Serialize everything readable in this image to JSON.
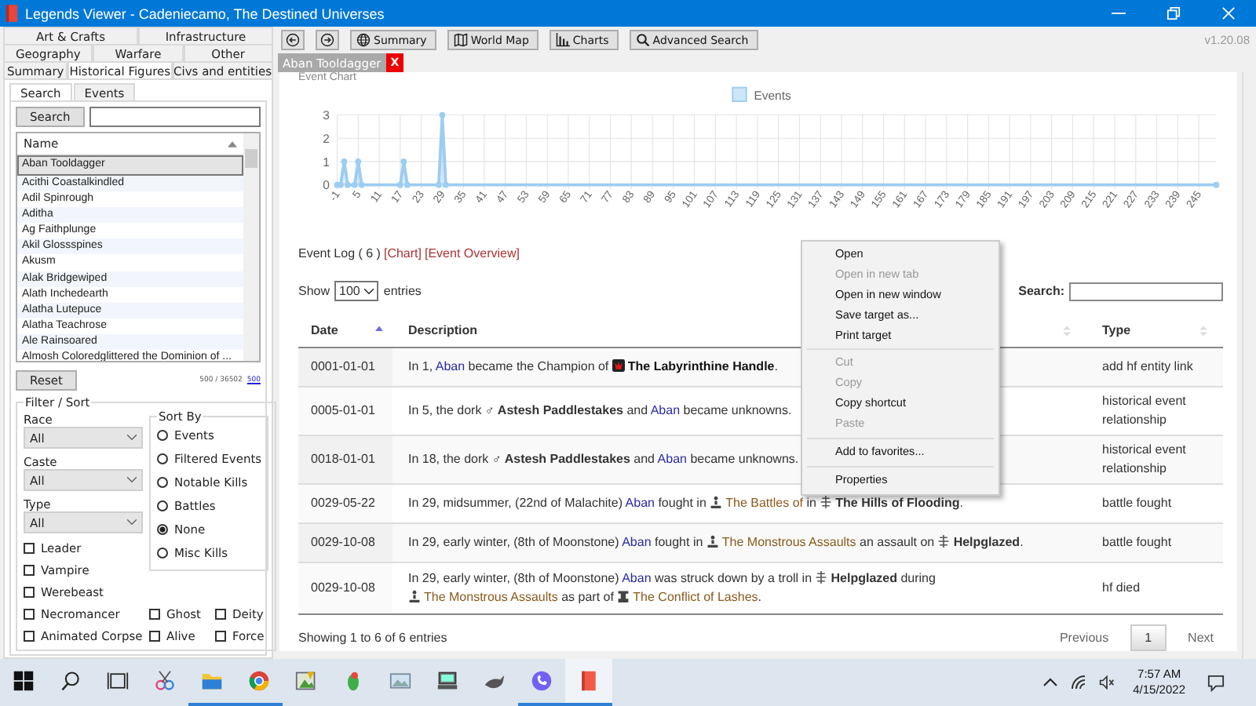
{
  "window": {
    "title": "Legends Viewer - Cadeniecamo, The Destined Universes"
  },
  "tab_rows": [
    {
      "tabs": [
        {
          "label": "Art & Crafts",
          "selected": false
        },
        {
          "label": "Infrastructure",
          "selected": false
        }
      ]
    },
    {
      "tabs": [
        {
          "label": "Geography",
          "selected": false
        },
        {
          "label": "Warfare",
          "selected": false
        },
        {
          "label": "Other",
          "selected": false
        }
      ]
    },
    {
      "tabs": [
        {
          "label": "Summary",
          "selected": false
        },
        {
          "label": "Historical Figures",
          "selected": true
        },
        {
          "label": "Civs and entities",
          "selected": false
        }
      ]
    }
  ],
  "sub_tabs": [
    {
      "label": "Search",
      "selected": true
    },
    {
      "label": "Events",
      "selected": false
    }
  ],
  "search_button": "Search",
  "list": {
    "column": "Name",
    "items": [
      {
        "name": "Aban Tooldagger",
        "selected": true
      },
      {
        "name": "Acithi Coastalkindled",
        "selected": false
      },
      {
        "name": "Adil Spinrough",
        "selected": false
      },
      {
        "name": "Aditha",
        "selected": false
      },
      {
        "name": "Ag Faithplunge",
        "selected": false
      },
      {
        "name": "Akil Glossspines",
        "selected": false
      },
      {
        "name": "Akusm",
        "selected": false
      },
      {
        "name": "Alak Bridgewiped",
        "selected": false
      },
      {
        "name": "Alath Inchedearth",
        "selected": false
      },
      {
        "name": "Alatha Lutepuce",
        "selected": false
      },
      {
        "name": "Alatha Teachrose",
        "selected": false
      },
      {
        "name": "Ale Rainsoared",
        "selected": false
      },
      {
        "name": "Almosh Coloredglittered the Dominion of ...",
        "selected": false
      }
    ]
  },
  "reset_button": "Reset",
  "count": "500 / 36502",
  "count_link": "500",
  "filter": {
    "title": "Filter / Sort",
    "dropdowns": [
      {
        "label": "Race",
        "value": "All"
      },
      {
        "label": "Caste",
        "value": "All"
      },
      {
        "label": "Type",
        "value": "All"
      }
    ],
    "checkboxes": [
      {
        "label": "Leader",
        "checked": false
      },
      {
        "label": "Vampire",
        "checked": false
      },
      {
        "label": "Werebeast",
        "checked": false
      },
      {
        "label": "Necromancer",
        "checked": false
      },
      {
        "label": "Ghost",
        "checked": false
      },
      {
        "label": "Deity",
        "checked": false
      },
      {
        "label": "Animated Corpse",
        "checked": false
      },
      {
        "label": "Alive",
        "checked": false
      },
      {
        "label": "Force",
        "checked": false
      }
    ],
    "sort": {
      "title": "Sort By",
      "options": [
        {
          "label": "Events",
          "selected": false
        },
        {
          "label": "Filtered Events",
          "selected": false
        },
        {
          "label": "Notable Kills",
          "selected": false
        },
        {
          "label": "Battles",
          "selected": false
        },
        {
          "label": "None",
          "selected": true
        },
        {
          "label": "Misc Kills",
          "selected": false
        }
      ]
    }
  },
  "toolbar": {
    "buttons": [
      {
        "kind": "back"
      },
      {
        "kind": "forward"
      },
      {
        "kind": "globe",
        "label": "Summary"
      },
      {
        "kind": "map",
        "label": "World Map"
      },
      {
        "kind": "chart",
        "label": "Charts"
      },
      {
        "kind": "search",
        "label": "Advanced Search"
      }
    ],
    "version": "v1.20.08"
  },
  "doc_tab": {
    "label": "Aban Tooldagger",
    "close": "X"
  },
  "event_chart": {
    "title": "Event Chart",
    "chart_data": {
      "type": "line",
      "grid": true,
      "series": [
        {
          "name": "Events",
          "color": "#9ccdf2",
          "marker": "circle",
          "values": [
            0,
            0,
            1,
            0,
            0,
            1,
            0,
            0,
            1,
            0,
            0,
            3,
            0,
            0
          ]
        }
      ],
      "x": [
        -1,
        0,
        1,
        2,
        4,
        5,
        6,
        17,
        18,
        19,
        28,
        29,
        30,
        250
      ],
      "xlim": [
        -1,
        250
      ],
      "ylim": [
        0,
        3
      ],
      "yticks": [
        0,
        1,
        2,
        3
      ],
      "xticks": [
        -1,
        5,
        11,
        17,
        23,
        29,
        35,
        41,
        47,
        53,
        59,
        65,
        71,
        77,
        83,
        89,
        95,
        101,
        107,
        113,
        119,
        125,
        131,
        137,
        143,
        149,
        155,
        161,
        167,
        173,
        179,
        185,
        191,
        197,
        203,
        209,
        215,
        221,
        227,
        233,
        239,
        245
      ]
    }
  },
  "event_log": {
    "title": "Event Log ( 6 )",
    "links": [
      "[Chart]",
      "[Event Overview]"
    ]
  },
  "table": {
    "show_label": "Show",
    "page_size": "100",
    "entries_label": "entries",
    "search_label": "Search:",
    "columns": [
      {
        "label": "Date",
        "sorted": true
      },
      {
        "label": "Description",
        "sorted": false
      },
      {
        "label": "Type",
        "sorted": false
      }
    ],
    "rows": [
      {
        "date": "0001-01-01",
        "type": "add hf entity link",
        "description": [
          {
            "kind": "text",
            "text": "In 1, "
          },
          {
            "kind": "hf",
            "text": "Aban"
          },
          {
            "kind": "text",
            "text": " became the Champion of "
          },
          {
            "kind": "artifact",
            "text": "The Labyrinthine Handle"
          },
          {
            "kind": "text",
            "text": "."
          }
        ]
      },
      {
        "date": "0005-01-01",
        "type": "historical event relationship",
        "description": [
          {
            "kind": "text",
            "text": "In 5, the dork "
          },
          {
            "kind": "figure",
            "icon": "♂",
            "text": "Astesh Paddlestakes"
          },
          {
            "kind": "text",
            "text": " and "
          },
          {
            "kind": "hf",
            "text": "Aban"
          },
          {
            "kind": "text",
            "text": " became unknowns."
          }
        ]
      },
      {
        "date": "0018-01-01",
        "type": "historical event relationship",
        "description": [
          {
            "kind": "text",
            "text": "In 18, the dork "
          },
          {
            "kind": "figure",
            "icon": "♂",
            "text": "Astesh Paddlestakes"
          },
          {
            "kind": "text",
            "text": " and "
          },
          {
            "kind": "hf",
            "text": "Aban"
          },
          {
            "kind": "text",
            "text": " became unknowns."
          }
        ]
      },
      {
        "date": "0029-05-22",
        "type": "battle fought",
        "description": [
          {
            "kind": "text",
            "text": "In 29, midsummer, (22nd of Malachite) "
          },
          {
            "kind": "hf",
            "text": "Aban"
          },
          {
            "kind": "text",
            "text": " fought in "
          },
          {
            "kind": "battle",
            "text": "The Battles of"
          },
          {
            "kind": "text",
            "text": " in "
          },
          {
            "kind": "site",
            "text": "The Hills of Flooding"
          },
          {
            "kind": "text",
            "text": "."
          }
        ]
      },
      {
        "date": "0029-10-08",
        "type": "battle fought",
        "description": [
          {
            "kind": "text",
            "text": "In 29, early winter, (8th of Moonstone) "
          },
          {
            "kind": "hf",
            "text": "Aban"
          },
          {
            "kind": "text",
            "text": " fought in "
          },
          {
            "kind": "battle",
            "text": "The Monstrous Assaults"
          },
          {
            "kind": "text",
            "text": " an assault on "
          },
          {
            "kind": "site",
            "text": "Helpglazed"
          },
          {
            "kind": "text",
            "text": "."
          }
        ]
      },
      {
        "date": "0029-10-08",
        "type": "hf died",
        "description": [
          {
            "kind": "text",
            "text": "In 29, early winter, (8th of Moonstone) "
          },
          {
            "kind": "hf",
            "text": "Aban"
          },
          {
            "kind": "text",
            "text": " was struck down by a troll in "
          },
          {
            "kind": "site",
            "text": "Helpglazed"
          },
          {
            "kind": "text",
            "text": " during "
          },
          {
            "kind": "battle",
            "text": "The Monstrous Assaults"
          },
          {
            "kind": "text",
            "text": " as part of "
          },
          {
            "kind": "war",
            "text": "The Conflict of Lashes"
          },
          {
            "kind": "text",
            "text": "."
          }
        ]
      }
    ],
    "info": "Showing 1 to 6 of 6 entries",
    "pagination": {
      "previous": "Previous",
      "pages": [
        {
          "label": "1",
          "selected": true
        }
      ],
      "next": "Next"
    }
  },
  "context_menu": {
    "groups": [
      {
        "items": [
          {
            "label": "Open",
            "disabled": false
          },
          {
            "label": "Open in new tab",
            "disabled": true
          },
          {
            "label": "Open in new window",
            "disabled": false
          },
          {
            "label": "Save target as...",
            "disabled": false
          },
          {
            "label": "Print target",
            "disabled": false
          }
        ]
      },
      {
        "items": [
          {
            "label": "Cut",
            "disabled": true
          },
          {
            "label": "Copy",
            "disabled": true
          },
          {
            "label": "Copy shortcut",
            "disabled": false
          },
          {
            "label": "Paste",
            "disabled": true
          }
        ]
      },
      {
        "items": [
          {
            "label": "Add to favorites...",
            "disabled": false
          }
        ]
      },
      {
        "items": [
          {
            "label": "Properties",
            "disabled": false
          }
        ]
      }
    ]
  },
  "taskbar": {
    "apps": [
      {
        "kind": "start",
        "running": false
      },
      {
        "kind": "search",
        "running": false
      },
      {
        "kind": "taskview",
        "running": false
      },
      {
        "kind": "snip",
        "running": false
      },
      {
        "kind": "folder",
        "running": true
      },
      {
        "kind": "browser",
        "running": true
      },
      {
        "kind": "paint",
        "running": false
      },
      {
        "kind": "bird",
        "running": false
      },
      {
        "kind": "photo",
        "running": false
      },
      {
        "kind": "computer",
        "running": false
      },
      {
        "kind": "animal",
        "running": false
      },
      {
        "kind": "phone",
        "running": true
      },
      {
        "kind": "book",
        "running": true
      }
    ],
    "time": "7:57 AM",
    "date": "4/15/2022"
  }
}
